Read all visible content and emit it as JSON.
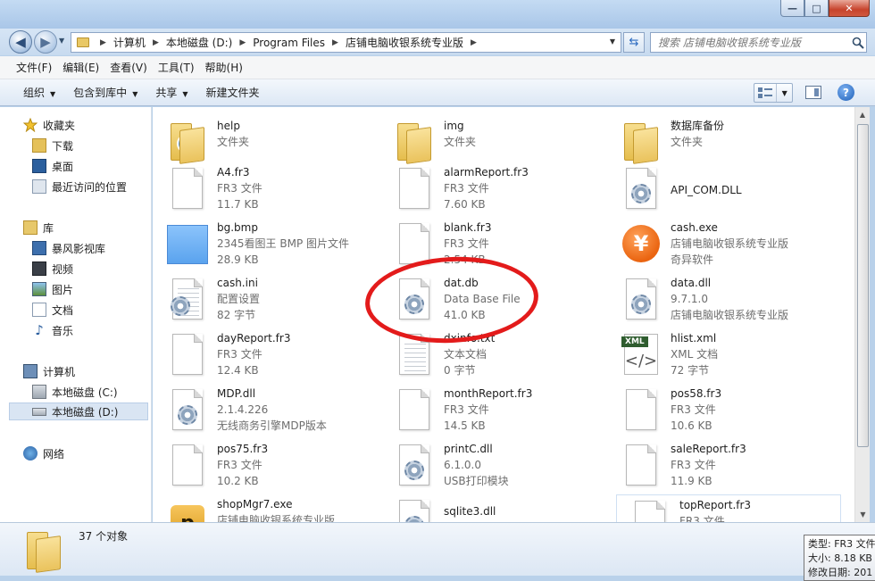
{
  "window": {
    "minimize": "—",
    "maximize": "□",
    "close": "✕"
  },
  "address_bar": {
    "crumbs": [
      "计算机",
      "本地磁盘 (D:)",
      "Program Files",
      "店铺电脑收银系统专业版"
    ],
    "search_placeholder": "搜索 店铺电脑收银系统专业版"
  },
  "menu": [
    "文件(F)",
    "编辑(E)",
    "查看(V)",
    "工具(T)",
    "帮助(H)"
  ],
  "commands": {
    "organize": "组织",
    "include_library": "包含到库中",
    "share": "共享",
    "new_folder": "新建文件夹"
  },
  "nav": {
    "favorites": "收藏夹",
    "downloads": "下载",
    "desktop": "桌面",
    "recent": "最近访问的位置",
    "libraries": "库",
    "baofeng": "暴风影视库",
    "videos": "视频",
    "pictures": "图片",
    "documents": "文档",
    "music": "音乐",
    "computer": "计算机",
    "drive_c": "本地磁盘 (C:)",
    "drive_d": "本地磁盘 (D:)",
    "network": "网络"
  },
  "files": [
    {
      "name": "help",
      "l1": "文件夹",
      "l2": "",
      "icon": "folder-icon"
    },
    {
      "name": "img",
      "l1": "文件夹",
      "l2": "",
      "icon": "folder-icon"
    },
    {
      "name": "数据库备份",
      "l1": "文件夹",
      "l2": "",
      "icon": "folder-icon"
    },
    {
      "name": "A4.fr3",
      "l1": "FR3 文件",
      "l2": "11.7 KB",
      "icon": "document-icon"
    },
    {
      "name": "alarmReport.fr3",
      "l1": "FR3 文件",
      "l2": "7.60 KB",
      "icon": "document-icon"
    },
    {
      "name": "API_COM.DLL",
      "l1": "",
      "l2": "",
      "icon": "dll-icon"
    },
    {
      "name": "bg.bmp",
      "l1": "2345看图王 BMP 图片文件",
      "l2": "28.9 KB",
      "icon": "bitmap-icon"
    },
    {
      "name": "blank.fr3",
      "l1": "FR3 文件",
      "l2": "2.54 KB",
      "icon": "document-icon"
    },
    {
      "name": "cash.exe",
      "l1": "店铺电脑收银系统专业版",
      "l2": "奇异软件",
      "icon": "yen-app-icon"
    },
    {
      "name": "cash.ini",
      "l1": "配置设置",
      "l2": "82 字节",
      "icon": "settings-file-icon"
    },
    {
      "name": "dat.db",
      "l1": "Data Base File",
      "l2": "41.0 KB",
      "icon": "database-file-icon"
    },
    {
      "name": "data.dll",
      "l1": "9.7.1.0",
      "l2": "店铺电脑收银系统专业版",
      "icon": "dll-icon"
    },
    {
      "name": "dayReport.fr3",
      "l1": "FR3 文件",
      "l2": "12.4 KB",
      "icon": "document-icon"
    },
    {
      "name": "dxinfo.txt",
      "l1": "文本文档",
      "l2": "0 字节",
      "icon": "text-file-icon"
    },
    {
      "name": "hlist.xml",
      "l1": "XML 文档",
      "l2": "72 字节",
      "icon": "xml-file-icon"
    },
    {
      "name": "MDP.dll",
      "l1": "2.1.4.226",
      "l2": "无线商务引擎MDP版本",
      "icon": "dll-icon"
    },
    {
      "name": "monthReport.fr3",
      "l1": "FR3 文件",
      "l2": "14.5 KB",
      "icon": "document-icon"
    },
    {
      "name": "pos58.fr3",
      "l1": "FR3 文件",
      "l2": "10.6 KB",
      "icon": "document-icon"
    },
    {
      "name": "pos75.fr3",
      "l1": "FR3 文件",
      "l2": "10.2 KB",
      "icon": "document-icon"
    },
    {
      "name": "printC.dll",
      "l1": "6.1.0.0",
      "l2": "USB打印模块",
      "icon": "dll-icon"
    },
    {
      "name": "saleReport.fr3",
      "l1": "FR3 文件",
      "l2": "11.9 KB",
      "icon": "document-icon"
    },
    {
      "name": "shopMgr7.exe",
      "l1": "店铺电脑收银系统专业版",
      "l2": "",
      "icon": "shop-app-icon"
    },
    {
      "name": "sqlite3.dll",
      "l1": "",
      "l2": "",
      "icon": "dll-icon"
    },
    {
      "name": "topReport.fr3",
      "l1": "FR3 文件",
      "l2": "",
      "icon": "document-icon"
    }
  ],
  "status": {
    "count": "37 个对象"
  },
  "tooltip": {
    "type": "类型: FR3 文件",
    "size": "大小: 8.18 KB",
    "modified": "修改日期: 201"
  }
}
